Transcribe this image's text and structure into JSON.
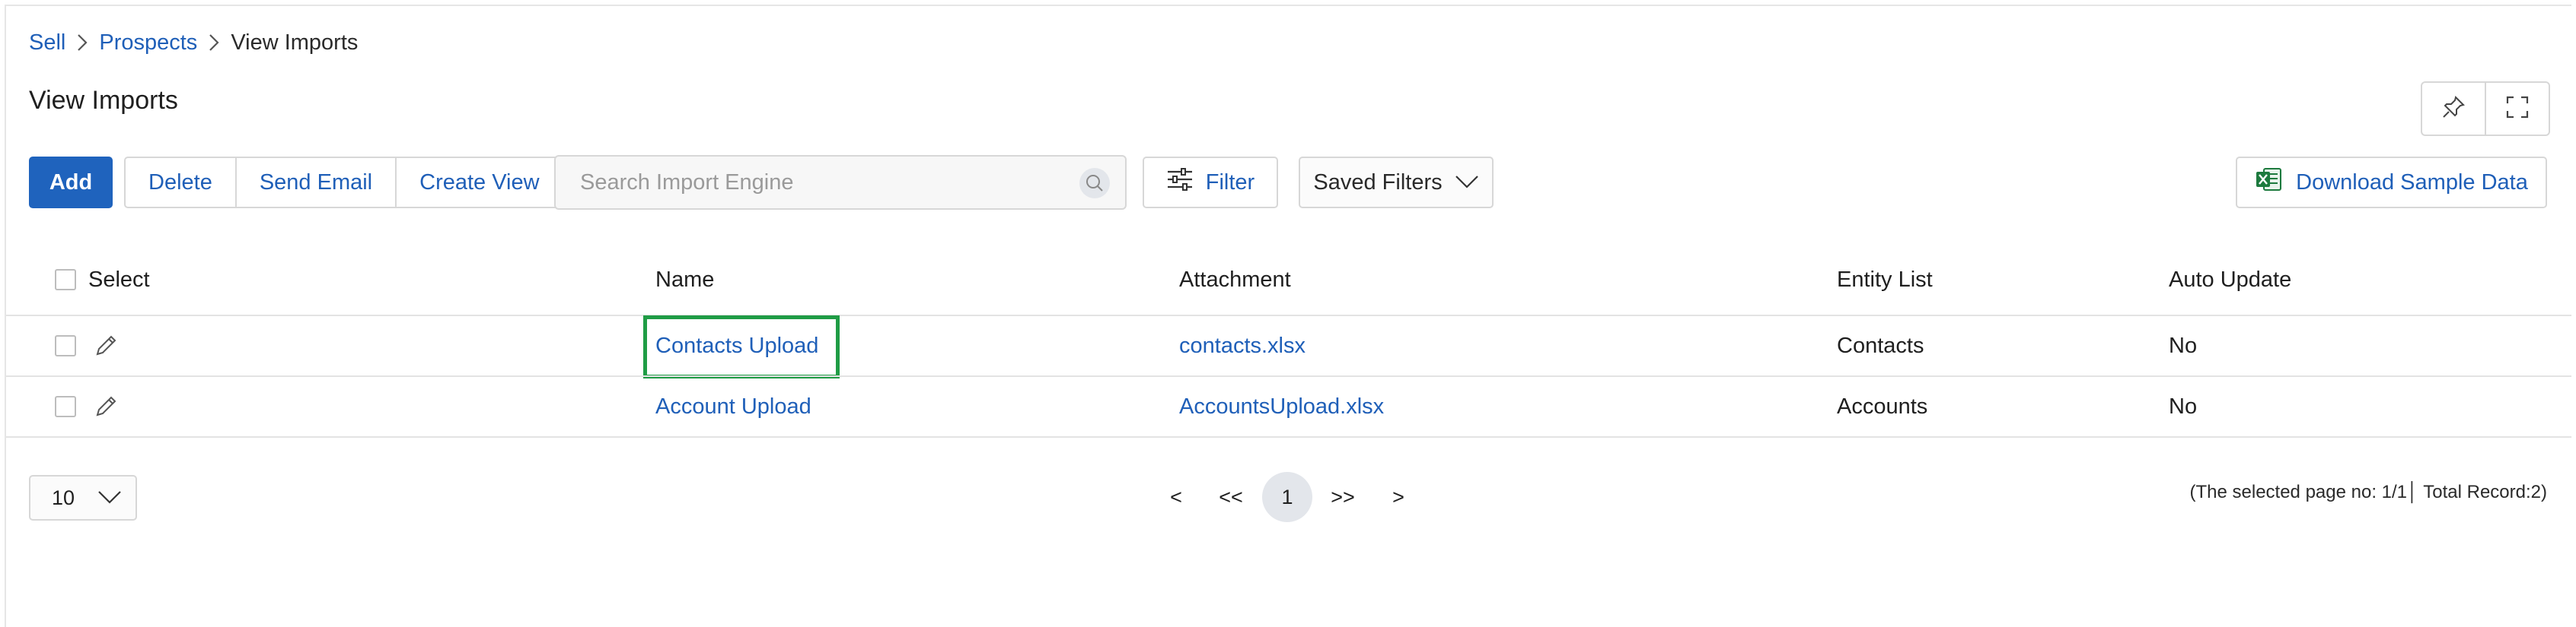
{
  "breadcrumb": {
    "items": [
      "Sell",
      "Prospects",
      "View Imports"
    ]
  },
  "page": {
    "title": "View Imports"
  },
  "toolbar": {
    "add_label": "Add",
    "delete_label": "Delete",
    "send_email_label": "Send Email",
    "create_view_label": "Create View",
    "search_placeholder": "Search Import Engine",
    "filter_label": "Filter",
    "saved_filters_label": "Saved Filters",
    "download_label": "Download Sample Data"
  },
  "table": {
    "columns": [
      "Select",
      "Name",
      "Attachment",
      "Entity List",
      "Auto Update"
    ],
    "rows": [
      {
        "name": "Contacts Upload",
        "attachment": "contacts.xlsx",
        "entity": "Contacts",
        "auto_update": "No"
      },
      {
        "name": "Account Upload",
        "attachment": "AccountsUpload.xlsx",
        "entity": "Accounts",
        "auto_update": "No"
      }
    ]
  },
  "pagination": {
    "page_size": "10",
    "prev": "<",
    "first": "<<",
    "current": "1",
    "last": ">>",
    "next": ">",
    "summary": "(The selected page no: 1/1│ Total Record:2)"
  },
  "colors": {
    "accent": "#1f63bd",
    "link": "#1f5fb8",
    "highlight": "#1f9c45",
    "excel": "#1d7a3e"
  },
  "icons": [
    "chevron-right-icon",
    "pin-icon",
    "fullscreen-icon",
    "search-icon",
    "sliders-icon",
    "chevron-down-icon",
    "excel-icon",
    "pencil-icon"
  ]
}
